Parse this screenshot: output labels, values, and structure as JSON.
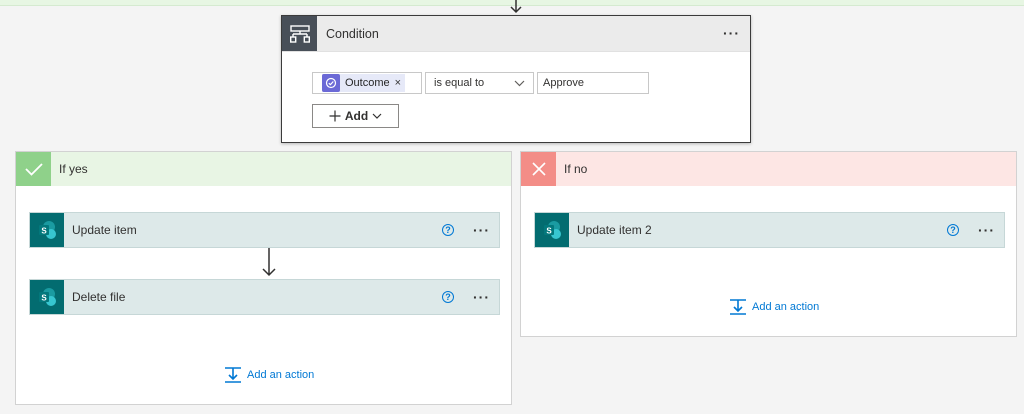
{
  "condition": {
    "title": "Condition",
    "menu_label": "···",
    "token_label": "Outcome",
    "token_remove": "×",
    "operator": "is equal to",
    "value": "Approve",
    "add_label": "Add"
  },
  "yes_branch": {
    "title": "If yes",
    "actions": [
      {
        "label": "Update item",
        "help": "?",
        "menu": "···"
      },
      {
        "label": "Delete file",
        "help": "?",
        "menu": "···"
      }
    ],
    "add_action": "Add an action"
  },
  "no_branch": {
    "title": "If no",
    "actions": [
      {
        "label": "Update item 2",
        "help": "?",
        "menu": "···"
      }
    ],
    "add_action": "Add an action"
  },
  "icons": {
    "condition": "condition-icon",
    "approval": "approval-icon",
    "sharepoint": "sharepoint-icon",
    "check": "check-icon",
    "cross": "cross-icon",
    "add_action": "add-action-icon"
  },
  "colors": {
    "accent": "#0078d4",
    "sharepoint": "#036c70",
    "yes": "#8fd18a",
    "no": "#f38d87",
    "approval": "#6b69d6"
  }
}
